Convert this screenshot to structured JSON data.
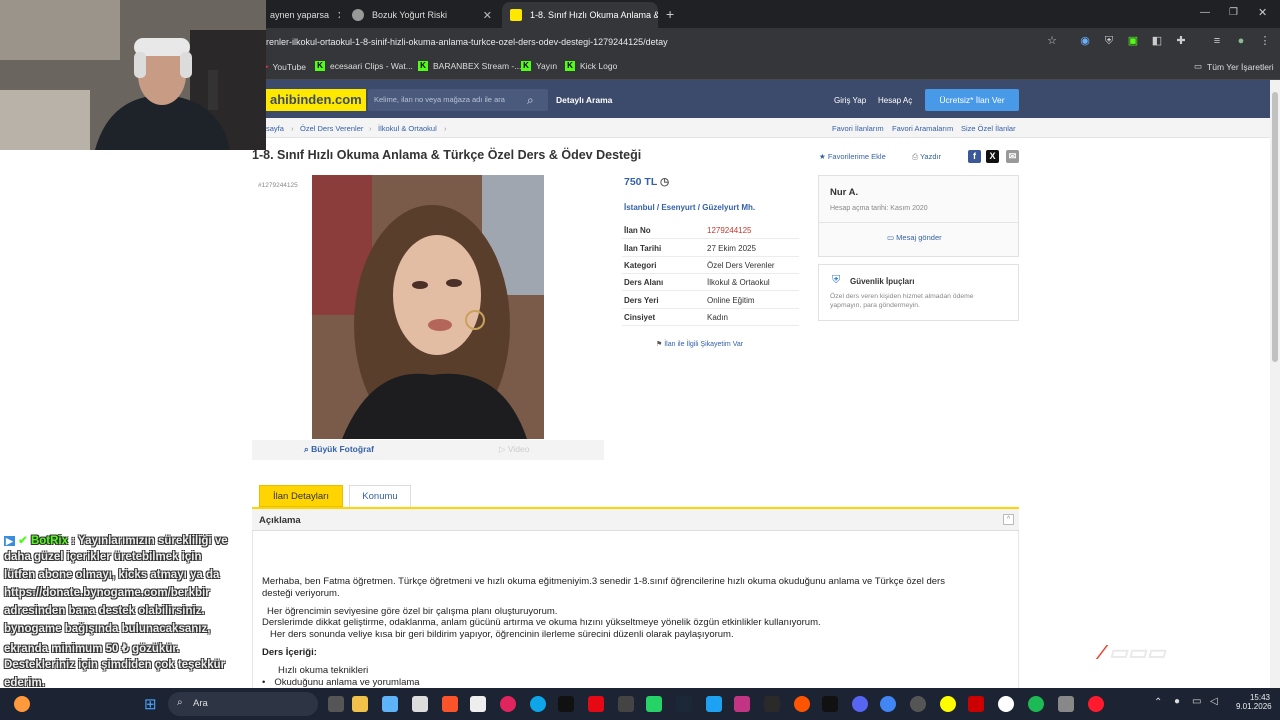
{
  "browser": {
    "tabs": [
      {
        "label": "aynen yaparsa",
        "active": false
      },
      {
        "label": "Bozuk Yoğurt Riski",
        "active": false
      },
      {
        "label": "1-8. Sınıf Hızlı Okuma Anlama &",
        "active": true
      }
    ],
    "url": "renler-ilkokul-ortaokul-1-8-sinif-hizli-okuma-anlama-turkce-ozel-ders-odev-destegi-1279244125/detay",
    "bookmarks": [
      "YouTube",
      "ecesaari Clips - Wat...",
      "BARANBEX Stream -...",
      "Yayın",
      "Kick Logo"
    ],
    "all_bookmarks": "Tüm Yer İşaretleri"
  },
  "site": {
    "logo": "ahibinden.com",
    "search_placeholder": "Kelime, ilan no veya mağaza adı ile ara",
    "detailed_search": "Detaylı Arama",
    "login": "Giriş Yap",
    "register": "Hesap Aç",
    "post_ad": "Ücretsiz* İlan Ver"
  },
  "breadcrumb": [
    "sayfa",
    "Özel Ders Verenler",
    "İlkokul & Ortaokul"
  ],
  "right_links": [
    "Favori İlanlarım",
    "Favori Aramalarım",
    "Size Özel İlanlar"
  ],
  "listing": {
    "title": "1-8. Sınıf Hızlı Okuma Anlama & Türkçe Özel Ders & Ödev Desteği",
    "add_favorite": "Favorilerime Ekle",
    "print": "Yazdır",
    "id_small": "#1279244125",
    "big_photo": "Büyük Fotoğraf",
    "video": "Video",
    "price": "750 TL",
    "location": "İstanbul  /  Esenyurt  /  Güzelyurt Mh.",
    "details": [
      {
        "key": "İlan No",
        "value": "1279244125"
      },
      {
        "key": "İlan Tarihi",
        "value": "27 Ekim 2025"
      },
      {
        "key": "Kategori",
        "value": "Özel Ders Verenler"
      },
      {
        "key": "Ders Alanı",
        "value": "İlkokul & Ortaokul"
      },
      {
        "key": "Ders Yeri",
        "value": "Online Eğitim"
      },
      {
        "key": "Cinsiyet",
        "value": "Kadın"
      }
    ],
    "complaint": "İlan ile İlgili Şikayetim Var"
  },
  "seller": {
    "name": "Nur A.",
    "since": "Hesap açma tarihi: Kasım 2020",
    "message": "Mesaj gönder",
    "safety_title": "Güvenlik İpuçları",
    "safety_text_1": "Özel ders veren kişiden hizmet almadan ödeme",
    "safety_text_2": "yapmayın, para göndermeyin."
  },
  "tabs": [
    "İlan Detayları",
    "Konumu"
  ],
  "description": {
    "header": "Açıklama",
    "line1": "Merhaba, ben Fatma öğretmen. Türkçe öğretmeni ve hızlı okuma eğitmeniyim.3 senedir  1-8.sınıf öğrencilerine hızlı okuma okuduğunu  anlama ve Türkçe özel ders",
    "line2": "desteği veriyorum.",
    "line3": "Her öğrencimin seviyesine göre özel bir çalışma planı oluşturuyorum.",
    "line4": "Derslerimde dikkat geliştirme, odaklanma, anlam gücünü artırma ve okuma hızını yükseltmeye yönelik özgün etkinlikler kullanıyorum.",
    "line5": "Her ders sonunda veliye kısa bir geri bildirim yapıyor, öğrencinin ilerleme sürecini düzenli olarak paylaşıyorum.",
    "content_title": "Ders İçeriği:",
    "bullet1": "Hızlı okuma teknikleri",
    "bullet2": "Okuduğunu anlama ve yorumlama"
  },
  "chat": {
    "user": "BotRix",
    "lines": [
      ": Yayınlarımızın sürekliliği ve",
      "daha güzel içerikler üretebilmek için",
      "lütfen abone olmayı, kicks atmayı ya da",
      "https://donate.bynogame.com/berkbir",
      "adresinden bana destek olabilirsiniz.",
      "bynogame bağışında bulunacaksanız,",
      "ekranda minimum 50 ₺ gözükür.",
      "Destekleriniz için şimdiden çok teşekkür",
      "ederim."
    ]
  },
  "taskbar": {
    "search": "Ara",
    "time": "15:43",
    "date": "9.01.2026"
  }
}
